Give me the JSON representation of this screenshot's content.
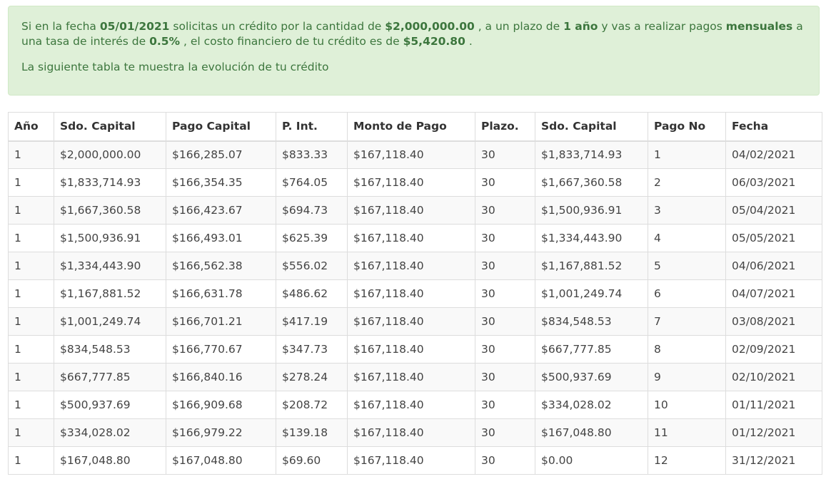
{
  "alert": {
    "p1": [
      {
        "text": "Si en la fecha ",
        "bold": false
      },
      {
        "text": "05/01/2021",
        "bold": true
      },
      {
        "text": " solicitas un crédito por la cantidad de ",
        "bold": false
      },
      {
        "text": "$2,000,000.00",
        "bold": true
      },
      {
        "text": " , a un plazo de ",
        "bold": false
      },
      {
        "text": "1 año",
        "bold": true
      },
      {
        "text": " y vas a realizar pagos ",
        "bold": false
      },
      {
        "text": "mensuales",
        "bold": true
      },
      {
        "text": " a una tasa de interés de ",
        "bold": false
      },
      {
        "text": "0.5%",
        "bold": true
      },
      {
        "text": " , el costo financiero de tu crédito es de ",
        "bold": false
      },
      {
        "text": "$5,420.80",
        "bold": true
      },
      {
        "text": " .",
        "bold": false
      }
    ],
    "p2": "La siguiente tabla te muestra la evolución de tu crédito",
    "colors": {
      "background": "#dff0d8",
      "text": "#3c763d",
      "border": "#d0e9c6"
    }
  },
  "table": {
    "headers": [
      "Año",
      "Sdo. Capital",
      "Pago Capital",
      "P. Int.",
      "Monto de Pago",
      "Plazo.",
      "Sdo. Capital",
      "Pago No",
      "Fecha"
    ],
    "rows": [
      [
        "1",
        "$2,000,000.00",
        "$166,285.07",
        "$833.33",
        "$167,118.40",
        "30",
        "$1,833,714.93",
        "1",
        "04/02/2021"
      ],
      [
        "1",
        "$1,833,714.93",
        "$166,354.35",
        "$764.05",
        "$167,118.40",
        "30",
        "$1,667,360.58",
        "2",
        "06/03/2021"
      ],
      [
        "1",
        "$1,667,360.58",
        "$166,423.67",
        "$694.73",
        "$167,118.40",
        "30",
        "$1,500,936.91",
        "3",
        "05/04/2021"
      ],
      [
        "1",
        "$1,500,936.91",
        "$166,493.01",
        "$625.39",
        "$167,118.40",
        "30",
        "$1,334,443.90",
        "4",
        "05/05/2021"
      ],
      [
        "1",
        "$1,334,443.90",
        "$166,562.38",
        "$556.02",
        "$167,118.40",
        "30",
        "$1,167,881.52",
        "5",
        "04/06/2021"
      ],
      [
        "1",
        "$1,167,881.52",
        "$166,631.78",
        "$486.62",
        "$167,118.40",
        "30",
        "$1,001,249.74",
        "6",
        "04/07/2021"
      ],
      [
        "1",
        "$1,001,249.74",
        "$166,701.21",
        "$417.19",
        "$167,118.40",
        "30",
        "$834,548.53",
        "7",
        "03/08/2021"
      ],
      [
        "1",
        "$834,548.53",
        "$166,770.67",
        "$347.73",
        "$167,118.40",
        "30",
        "$667,777.85",
        "8",
        "02/09/2021"
      ],
      [
        "1",
        "$667,777.85",
        "$166,840.16",
        "$278.24",
        "$167,118.40",
        "30",
        "$500,937.69",
        "9",
        "02/10/2021"
      ],
      [
        "1",
        "$500,937.69",
        "$166,909.68",
        "$208.72",
        "$167,118.40",
        "30",
        "$334,028.02",
        "10",
        "01/11/2021"
      ],
      [
        "1",
        "$334,028.02",
        "$166,979.22",
        "$139.18",
        "$167,118.40",
        "30",
        "$167,048.80",
        "11",
        "01/12/2021"
      ],
      [
        "1",
        "$167,048.80",
        "$167,048.80",
        "$69.60",
        "$167,118.40",
        "30",
        "$0.00",
        "12",
        "31/12/2021"
      ]
    ]
  }
}
